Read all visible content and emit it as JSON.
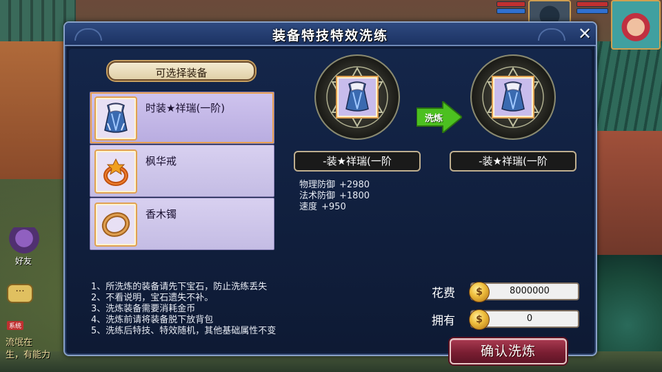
{
  "dialog": {
    "title": "装备特技特效洗练",
    "close_label": "✕"
  },
  "equipment_section": {
    "header": "可选择装备",
    "items": [
      {
        "name": "时装★祥瑞(一阶)",
        "icon": "cloak-icon",
        "selected": true
      },
      {
        "name": "枫华戒",
        "icon": "ring-icon",
        "selected": false
      },
      {
        "name": "香木镯",
        "icon": "bracelet-icon",
        "selected": false
      }
    ]
  },
  "refine": {
    "source_name": "-装★祥瑞(一阶",
    "target_name": "-装★祥瑞(一阶",
    "arrow_label": "洗炼",
    "stats": [
      {
        "label": "物理防御",
        "value": "+2980"
      },
      {
        "label": "法术防御",
        "value": "+1800"
      },
      {
        "label": "速度",
        "value": "+950"
      }
    ]
  },
  "notes": [
    "1、所洗炼的装备请先下宝石，防止洗练丢失",
    "2、不看说明，宝石遗失不补。",
    "3、洗炼装备需要消耗金币",
    "4、洗炼前请将装备脱下放背包",
    "5、洗练后特技、特效随机，其他基础属性不变"
  ],
  "cost": {
    "cost_label": "花费",
    "cost_value": "8000000",
    "owned_label": "拥有",
    "owned_value": "0",
    "coin_glyph": "$"
  },
  "confirm_label": "确认洗炼",
  "hud": {
    "friends_label": "好友",
    "chat_icon": "···",
    "chat_tag": "系统",
    "chat_lines": [
      "流氓在",
      "生，有能力"
    ]
  },
  "colors": {
    "panel_bg": "#0f1c38",
    "header_bg": "#2e4a80",
    "list_item_bg": "#d8d0f0",
    "confirm_bg": "#7a1e32",
    "arrow_green": "#4cc020"
  }
}
